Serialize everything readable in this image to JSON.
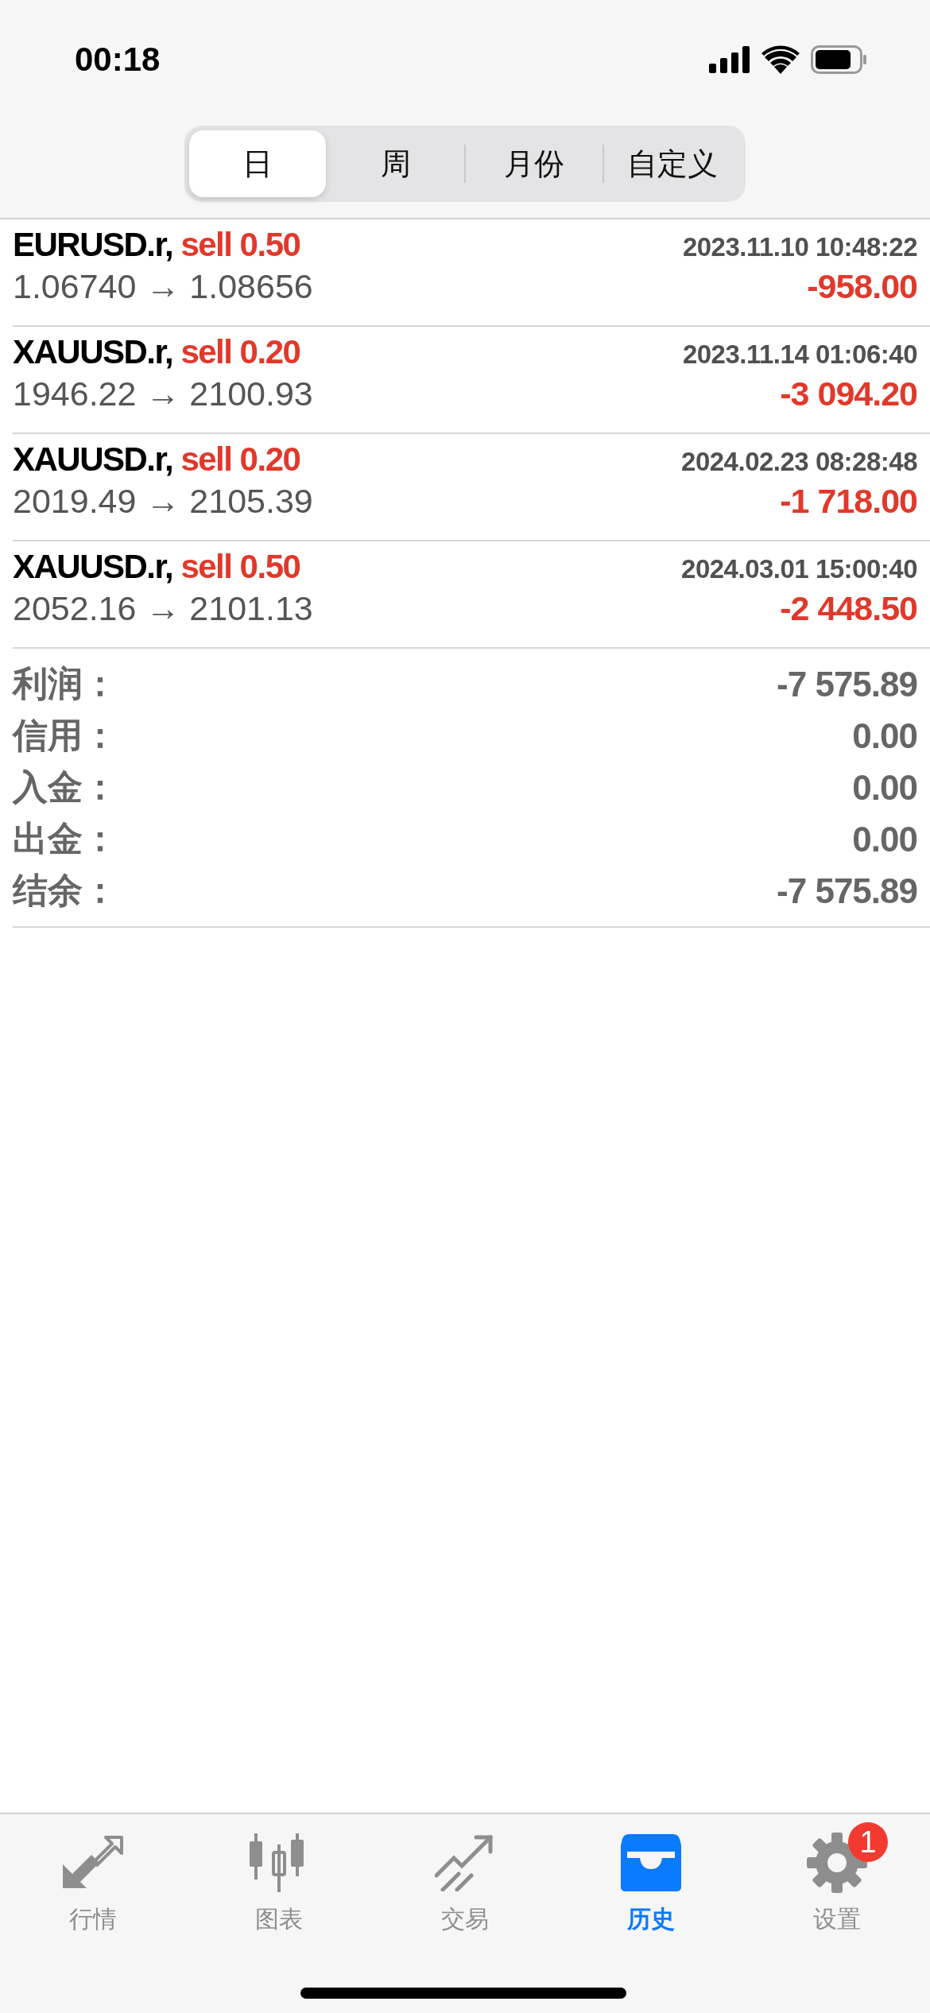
{
  "status_bar": {
    "time": "00:18"
  },
  "segments": [
    {
      "label": "日",
      "selected": true
    },
    {
      "label": "周",
      "selected": false
    },
    {
      "label": "月份",
      "selected": false
    },
    {
      "label": "自定义",
      "selected": false
    }
  ],
  "trades": [
    {
      "symbol": "EURUSD.r,",
      "side": "sell 0.50",
      "time": "2023.11.10 10:48:22",
      "prices": "1.06740 → 1.08656",
      "profit": "-958.00"
    },
    {
      "symbol": "XAUUSD.r,",
      "side": "sell 0.20",
      "time": "2023.11.14 01:06:40",
      "prices": "1946.22 → 2100.93",
      "profit": "-3 094.20"
    },
    {
      "symbol": "XAUUSD.r,",
      "side": "sell 0.20",
      "time": "2024.02.23 08:28:48",
      "prices": "2019.49 → 2105.39",
      "profit": "-1 718.00"
    },
    {
      "symbol": "XAUUSD.r,",
      "side": "sell 0.50",
      "time": "2024.03.01 15:00:40",
      "prices": "2052.16 → 2101.13",
      "profit": "-2 448.50"
    }
  ],
  "summary": [
    {
      "label": "利润：",
      "value": "-7 575.89"
    },
    {
      "label": "信用：",
      "value": "0.00"
    },
    {
      "label": "入金：",
      "value": "0.00"
    },
    {
      "label": "出金：",
      "value": "0.00"
    },
    {
      "label": "结余：",
      "value": "-7 575.89"
    }
  ],
  "tabs": [
    {
      "kind": "quotes",
      "label": "行情",
      "selected": false
    },
    {
      "kind": "chart",
      "label": "图表",
      "selected": false
    },
    {
      "kind": "trade",
      "label": "交易",
      "selected": false
    },
    {
      "kind": "history",
      "label": "历史",
      "selected": true
    },
    {
      "kind": "settings",
      "label": "设置",
      "selected": false,
      "badge": "1"
    }
  ]
}
